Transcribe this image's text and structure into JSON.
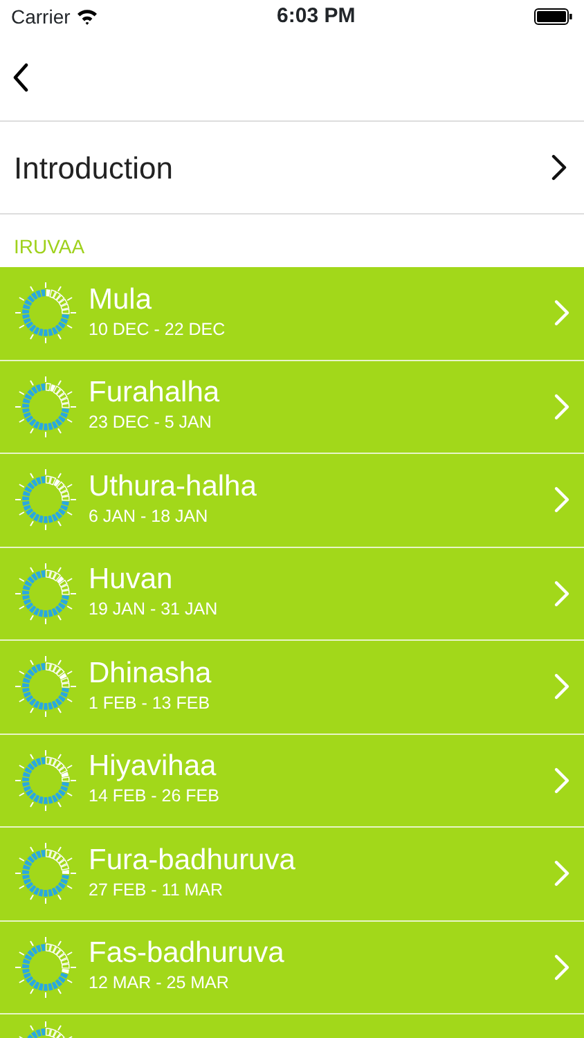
{
  "status_bar": {
    "carrier": "Carrier",
    "time": "6:03 PM"
  },
  "intro": {
    "label": "Introduction"
  },
  "section": {
    "title": "IRUVAA"
  },
  "items": [
    {
      "name": "Mula",
      "dates": "10 DEC - 22 DEC"
    },
    {
      "name": "Furahalha",
      "dates": "23 DEC - 5 JAN"
    },
    {
      "name": "Uthura-halha",
      "dates": "6 JAN - 18 JAN"
    },
    {
      "name": "Huvan",
      "dates": "19 JAN - 31 JAN"
    },
    {
      "name": "Dhinasha",
      "dates": "1 FEB - 13 FEB"
    },
    {
      "name": "Hiyavihaa",
      "dates": "14 FEB - 26 FEB"
    },
    {
      "name": "Fura-badhuruva",
      "dates": "27 FEB - 11 MAR"
    },
    {
      "name": "Fas-badhuruva",
      "dates": "12 MAR - 25 MAR"
    }
  ]
}
